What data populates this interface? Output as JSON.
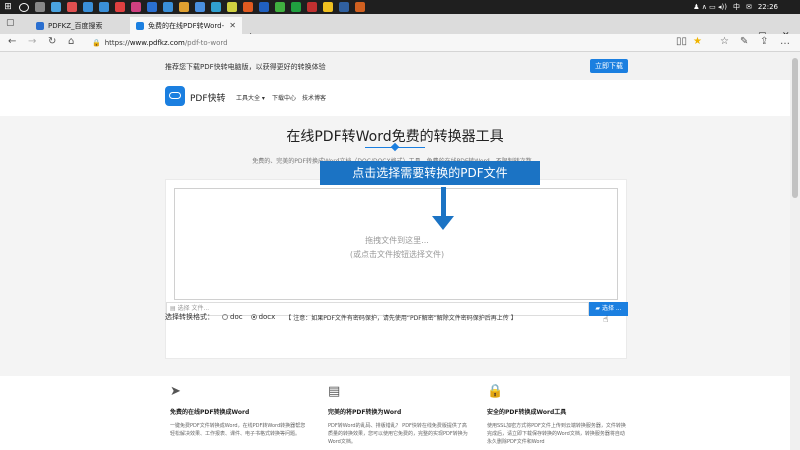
{
  "taskbar": {
    "ime": "中",
    "clock": "22:26"
  },
  "tabs": [
    {
      "label": "PDFKZ_百度搜索",
      "active": false
    },
    {
      "label": "免费的在线PDF转Word-",
      "active": true
    }
  ],
  "address_bar": {
    "protocol": "https://",
    "host": "www.pdfkz.com",
    "path": "/pdf-to-word"
  },
  "promo": {
    "text": "推荐您下载PDF快转电脑版，以获得更好的转换体验",
    "button": "立即下载"
  },
  "header": {
    "logo_text": "PDF快转",
    "menu": [
      "工具大全 ▾",
      "下载中心",
      "技术博客"
    ]
  },
  "hero": {
    "title": "在线PDF转Word免费的转换器工具",
    "subtitle": "免费的、完美的PDF转换成Word文档（DOC/DOCX格式）工具，免费的在线PDF转Word，不限制转次数。"
  },
  "upload": {
    "drop_main": "拖拽文件到这里...",
    "drop_sub": "(或点击文件按钮选择文件)",
    "file_placeholder": "选择 文件...",
    "choose_button": "选择 ...",
    "callout": "点击选择需要转换的PDF文件"
  },
  "format": {
    "label": "选择转换格式：",
    "options": [
      "doc",
      "docx"
    ],
    "selected": "docx",
    "notice": "【 注意：如果PDF文件有密码保护，请先使用“PDF解密”解除文件密码保护后再上传 】"
  },
  "features": [
    {
      "icon": "paper-plane-icon",
      "title": "免费的在线PDF转换成Word",
      "desc": "一键免费PDF文件转换成Word，在线PDF转Word转换器帮您轻松解决效果、工作报表、课件、电子书格式转换等问题。"
    },
    {
      "icon": "pdf-file-icon",
      "title": "完美的将PDF转换为Word",
      "desc": "PDF转Word的乱码、排版错乱？ PDF快转在线免费版提供了高质量的转换效果，您可以使用它免费的，完整的实现PDF转换为Word文档。"
    },
    {
      "icon": "lock-icon",
      "title": "安全的PDF转换成Word工具",
      "desc": "使用SSL加密方式将PDF文件上传到云端转换服务器，文件转换完成后，请立即下载保存转换的Word文档，转换服务器将自动永久删除PDF文件和Word"
    }
  ],
  "colors": {
    "brand": "#1b7fe0",
    "callout": "#1b73c4"
  }
}
